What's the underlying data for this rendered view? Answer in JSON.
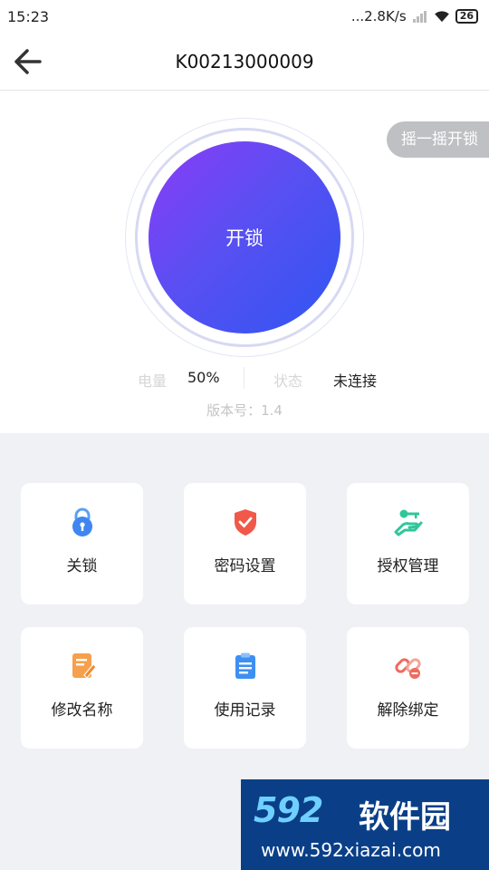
{
  "status_bar": {
    "time": "15:23",
    "net_speed": "...2.8K/s",
    "battery": "26"
  },
  "header": {
    "title": "K00213000009"
  },
  "lock": {
    "shake_label": "摇一摇开锁",
    "unlock_label": "开锁",
    "battery_label": "电量",
    "battery_value": "50%",
    "status_label": "状态",
    "status_value": "未连接",
    "version": "版本号：1.4"
  },
  "actions": [
    {
      "label": "关锁",
      "icon": "padlock-icon"
    },
    {
      "label": "密码设置",
      "icon": "shield-check-icon"
    },
    {
      "label": "授权管理",
      "icon": "hand-key-icon"
    },
    {
      "label": "修改名称",
      "icon": "edit-document-icon"
    },
    {
      "label": "使用记录",
      "icon": "clipboard-list-icon"
    },
    {
      "label": "解除绑定",
      "icon": "unlink-icon"
    }
  ],
  "watermark": {
    "brand": "592",
    "brand_cn": "软件园",
    "url": "www.592xiazai.com"
  },
  "colors": {
    "unlock_gradient_start": "#8b3cf7",
    "unlock_gradient_end": "#2f56f2",
    "page_bg": "#f0f1f5"
  }
}
